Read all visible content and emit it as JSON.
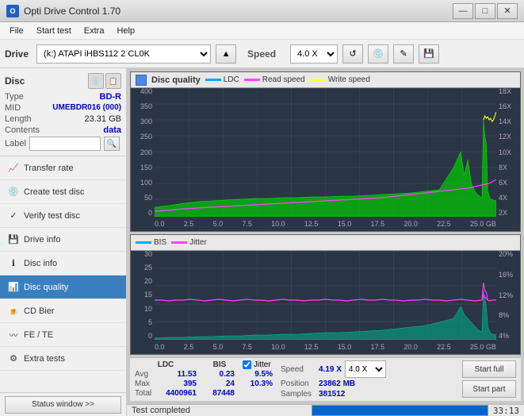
{
  "titlebar": {
    "title": "Opti Drive Control 1.70",
    "minimize": "—",
    "maximize": "□",
    "close": "✕"
  },
  "menu": {
    "items": [
      "File",
      "Start test",
      "Extra",
      "Help"
    ]
  },
  "toolbar": {
    "drive_label": "Drive",
    "drive_value": "(k:) ATAPI iHBS112  2 CL0K",
    "speed_label": "Speed",
    "speed_value": "4.0 X"
  },
  "disc": {
    "title": "Disc",
    "type_label": "Type",
    "type_value": "BD-R",
    "mid_label": "MID",
    "mid_value": "UMEBDR016 (000)",
    "length_label": "Length",
    "length_value": "23.31 GB",
    "contents_label": "Contents",
    "contents_value": "data",
    "label_label": "Label",
    "label_value": ""
  },
  "nav": [
    {
      "id": "transfer-rate",
      "label": "Transfer rate",
      "active": false
    },
    {
      "id": "create-test-disc",
      "label": "Create test disc",
      "active": false
    },
    {
      "id": "verify-test-disc",
      "label": "Verify test disc",
      "active": false
    },
    {
      "id": "drive-info",
      "label": "Drive info",
      "active": false
    },
    {
      "id": "disc-info",
      "label": "Disc info",
      "active": false
    },
    {
      "id": "disc-quality",
      "label": "Disc quality",
      "active": true
    },
    {
      "id": "cd-bier",
      "label": "CD Bier",
      "active": false
    },
    {
      "id": "fe-te",
      "label": "FE / TE",
      "active": false
    },
    {
      "id": "extra-tests",
      "label": "Extra tests",
      "active": false
    }
  ],
  "status_btn": "Status window >>",
  "chart1": {
    "title": "Disc quality",
    "legend": [
      {
        "label": "LDC",
        "color": "#00aaff"
      },
      {
        "label": "Read speed",
        "color": "#ff00ff"
      },
      {
        "label": "Write speed",
        "color": "#ffff00"
      }
    ],
    "y_labels_left": [
      "400",
      "350",
      "300",
      "250",
      "200",
      "150",
      "100",
      "50",
      "0"
    ],
    "y_labels_right": [
      "18X",
      "16X",
      "14X",
      "12X",
      "10X",
      "8X",
      "6X",
      "4X",
      "2X"
    ],
    "x_labels": [
      "0.0",
      "2.5",
      "5.0",
      "7.5",
      "10.0",
      "12.5",
      "15.0",
      "17.5",
      "20.0",
      "22.5",
      "25.0 GB"
    ]
  },
  "chart2": {
    "legend": [
      {
        "label": "BIS",
        "color": "#00aaff"
      },
      {
        "label": "Jitter",
        "color": "#ff00ff"
      }
    ],
    "y_labels_left": [
      "30",
      "25",
      "20",
      "15",
      "10",
      "5",
      "0"
    ],
    "y_labels_right": [
      "20%",
      "16%",
      "12%",
      "8%",
      "4%"
    ],
    "x_labels": [
      "0.0",
      "2.5",
      "5.0",
      "7.5",
      "10.0",
      "12.5",
      "15.0",
      "17.5",
      "20.0",
      "22.5",
      "25.0 GB"
    ]
  },
  "stats": {
    "ldc_label": "LDC",
    "bis_label": "BIS",
    "jitter_label": "Jitter",
    "speed_label": "Speed",
    "avg_label": "Avg",
    "ldc_avg": "11.53",
    "bis_avg": "0.23",
    "jitter_avg": "9.5%",
    "max_label": "Max",
    "ldc_max": "395",
    "bis_max": "24",
    "jitter_max": "10.3%",
    "total_label": "Total",
    "ldc_total": "4400961",
    "bis_total": "87448",
    "speed_value": "4.19 X",
    "speed_select": "4.0 X",
    "position_label": "Position",
    "position_value": "23862 MB",
    "samples_label": "Samples",
    "samples_value": "381512"
  },
  "buttons": {
    "start_full": "Start full",
    "start_part": "Start part"
  },
  "bottom": {
    "status_text": "Test completed",
    "progress": 100,
    "time": "33:13"
  }
}
